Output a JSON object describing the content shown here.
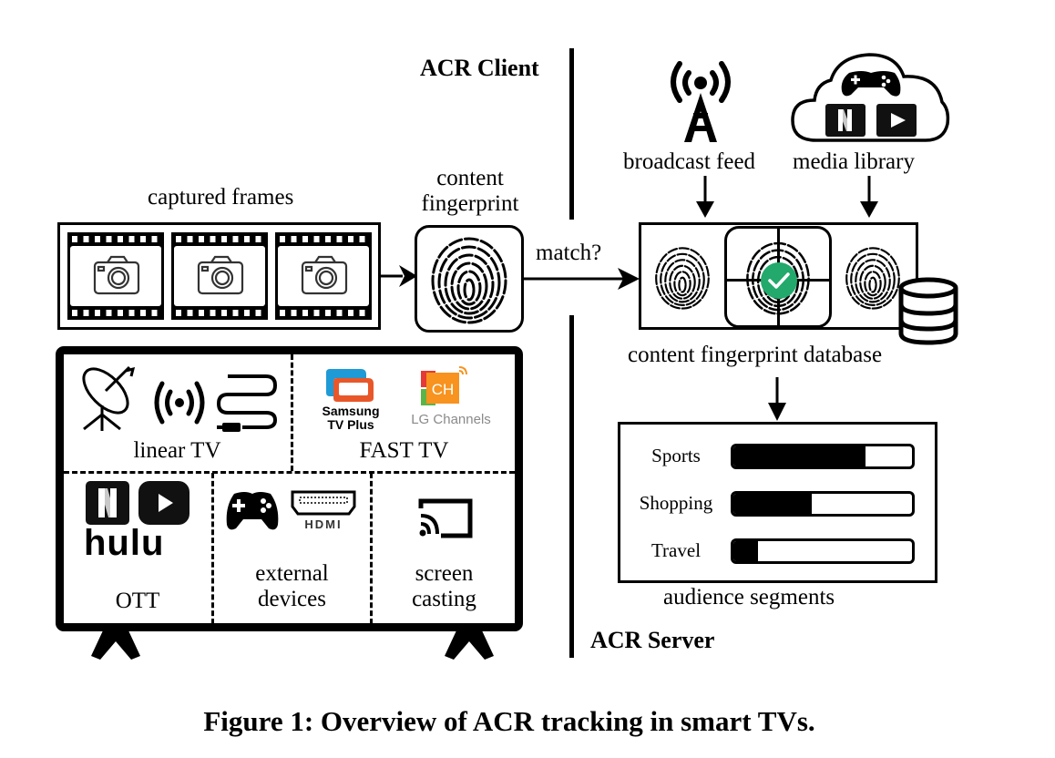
{
  "client_label": "ACR Client",
  "server_label": "ACR Server",
  "captured_frames": {
    "label": "captured frames",
    "frame_count": 3
  },
  "content_fingerprint": {
    "label_line1": "content",
    "label_line2": "fingerprint"
  },
  "match_label": "match?",
  "broadcast_feed": {
    "label": "broadcast feed",
    "icon": "radio-tower-icon"
  },
  "media_library": {
    "label": "media library",
    "icons": [
      "gamepad-icon",
      "netflix-icon",
      "youtube-icon"
    ]
  },
  "database": {
    "label": "content fingerprint database",
    "matched_index": 1
  },
  "audience_segments": {
    "label": "audience segments",
    "items": [
      {
        "name": "Sports",
        "fill": 0.74
      },
      {
        "name": "Shopping",
        "fill": 0.44
      },
      {
        "name": "Travel",
        "fill": 0.14
      }
    ]
  },
  "tv": {
    "sources": [
      {
        "label": "linear TV",
        "icons": [
          "satellite-dish-icon",
          "broadcast-signal-icon",
          "cable-icon"
        ]
      },
      {
        "label": "FAST TV",
        "logos": [
          {
            "line1": "Samsung",
            "line2": "TV Plus"
          },
          {
            "text": "LG Channels",
            "badge": "CH"
          }
        ]
      },
      {
        "label": "OTT",
        "logo_text": "hulu"
      },
      {
        "label_line1": "external",
        "label_line2": "devices",
        "hdmi_text": "HDMI"
      },
      {
        "label_line1": "screen",
        "label_line2": "casting"
      }
    ]
  },
  "colors": {
    "check_green": "#22a96b",
    "samsung_blue": "#1e9ad6",
    "samsung_orange": "#e8572a",
    "lg_red": "#e53935",
    "lg_green": "#5bb446",
    "lg_orange": "#f7931e",
    "lg_text": "#8a8a8a"
  },
  "caption": "Figure 1: Overview of ACR tracking in smart TVs."
}
